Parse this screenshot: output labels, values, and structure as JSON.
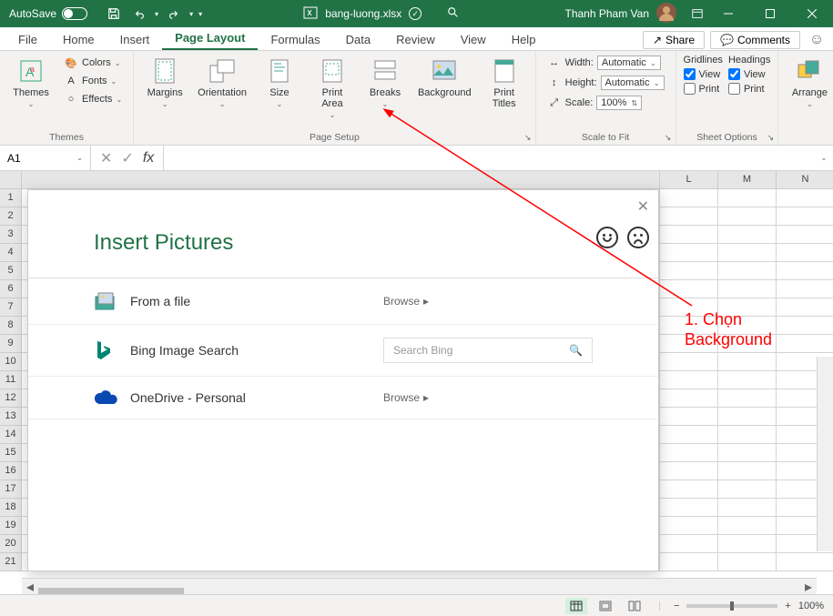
{
  "titlebar": {
    "autosave_label": "AutoSave",
    "autosave_state": "Off",
    "filename": "bang-luong.xlsx",
    "save_status": "Saved",
    "username": "Thanh Pham Van"
  },
  "tabs": {
    "file": "File",
    "home": "Home",
    "insert": "Insert",
    "page_layout": "Page Layout",
    "formulas": "Formulas",
    "data": "Data",
    "review": "Review",
    "view": "View",
    "help": "Help"
  },
  "ribbon_right": {
    "share": "Share",
    "comments": "Comments"
  },
  "ribbon": {
    "themes": {
      "themes": "Themes",
      "colors": "Colors",
      "fonts": "Fonts",
      "effects": "Effects",
      "group": "Themes"
    },
    "page_setup": {
      "margins": "Margins",
      "orientation": "Orientation",
      "size": "Size",
      "print_area": "Print\nArea",
      "breaks": "Breaks",
      "background": "Background",
      "print_titles": "Print\nTitles",
      "group": "Page Setup"
    },
    "scale": {
      "width_label": "Width:",
      "width_value": "Automatic",
      "height_label": "Height:",
      "height_value": "Automatic",
      "scale_label": "Scale:",
      "scale_value": "100%",
      "group": "Scale to Fit"
    },
    "sheet_options": {
      "gridlines": "Gridlines",
      "headings": "Headings",
      "view": "View",
      "print": "Print",
      "group": "Sheet Options"
    },
    "arrange": {
      "arrange": "Arrange",
      "group": ""
    }
  },
  "formula_bar": {
    "cell_ref": "A1",
    "fx": "fx"
  },
  "columns": [
    "L",
    "M",
    "N"
  ],
  "rows": [
    "1",
    "2",
    "3",
    "4",
    "5",
    "6",
    "7",
    "8",
    "9",
    "10",
    "11",
    "12",
    "13",
    "14",
    "15",
    "16",
    "17",
    "18",
    "19",
    "20",
    "21"
  ],
  "dialog": {
    "title": "Insert Pictures",
    "from_file": "From a file",
    "browse": "Browse",
    "bing": "Bing Image Search",
    "search_placeholder": "Search Bing",
    "onedrive": "OneDrive - Personal"
  },
  "annotation": {
    "text": "1. Chọn\nBackground"
  },
  "statusbar": {
    "zoom": "100%"
  }
}
